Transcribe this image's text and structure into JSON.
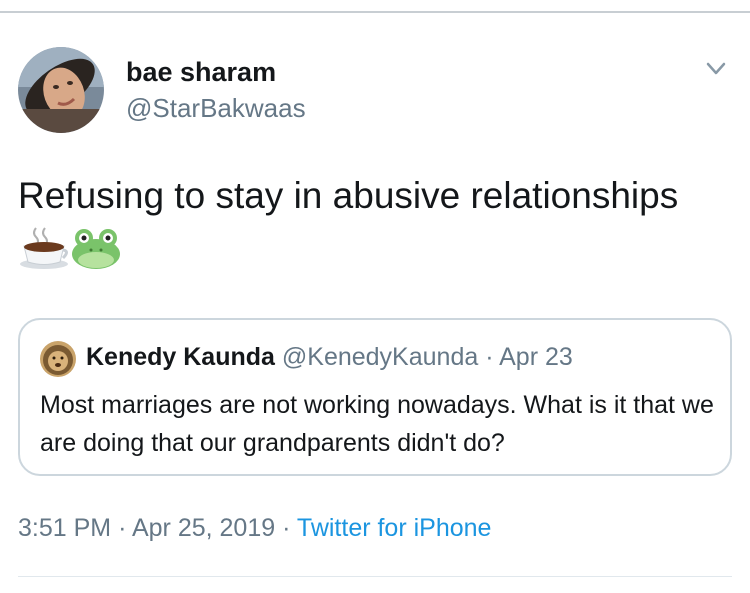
{
  "tweet": {
    "display_name": "bae sharam",
    "handle": "@StarBakwaas",
    "text": "Refusing to stay in abusive relationships",
    "emojis": [
      "hot-beverage-icon",
      "frog-icon"
    ]
  },
  "quoted_tweet": {
    "display_name": "Kenedy Kaunda",
    "handle": "@KenedyKaunda",
    "separator": "·",
    "date": "Apr 23",
    "text": "Most marriages are not working nowadays. What is it that we are doing that our grandparents didn't do?"
  },
  "footer": {
    "time": "3:51 PM",
    "separator": "·",
    "date": "Apr 25, 2019",
    "source": "Twitter for iPhone"
  },
  "colors": {
    "text_primary": "#14171a",
    "text_secondary": "#657786",
    "link": "#1b95e0",
    "border": "#ccd6dd"
  }
}
